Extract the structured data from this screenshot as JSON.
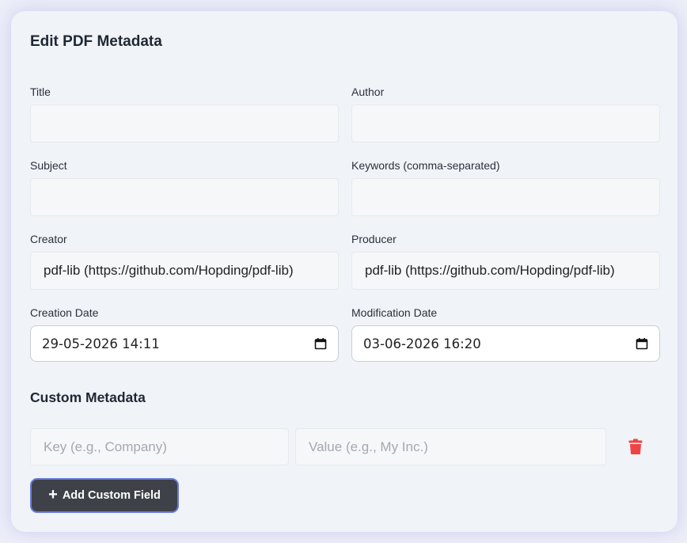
{
  "title": "Edit PDF Metadata",
  "fields": {
    "title": {
      "label": "Title",
      "value": ""
    },
    "author": {
      "label": "Author",
      "value": ""
    },
    "subject": {
      "label": "Subject",
      "value": ""
    },
    "keywords": {
      "label": "Keywords (comma-separated)",
      "value": ""
    },
    "creator": {
      "label": "Creator",
      "value": "pdf-lib (https://github.com/Hopding/pdf-lib)"
    },
    "producer": {
      "label": "Producer",
      "value": "pdf-lib (https://github.com/Hopding/pdf-lib)"
    },
    "creation_date": {
      "label": "Creation Date",
      "value": "29-05-2026 14:11"
    },
    "modification_date": {
      "label": "Modification Date",
      "value": "03-06-2026 16:20"
    }
  },
  "custom": {
    "heading": "Custom Metadata",
    "key_placeholder": "Key (e.g., Company)",
    "value_placeholder": "Value (e.g., My Inc.)",
    "delete_icon": "trash-icon",
    "add_button_label": "Add Custom Field",
    "add_icon": "plus-icon"
  },
  "colors": {
    "delete": "#ef4444",
    "button_bg": "#3f4149",
    "button_border": "#6a7bd8"
  }
}
